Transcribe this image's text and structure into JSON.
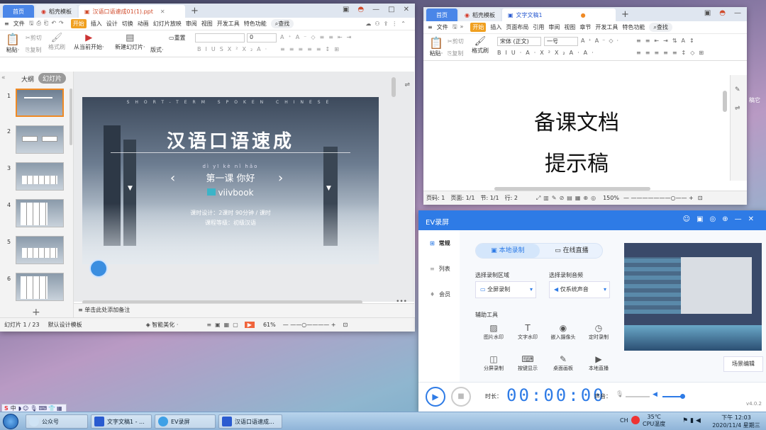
{
  "ppt": {
    "tabs": {
      "home": "首页",
      "template": "稻壳模板",
      "doc": "汉语口语速成01(1).ppt"
    },
    "menu": [
      "文件",
      "开始",
      "插入",
      "设计",
      "切换",
      "动画",
      "幻灯片放映",
      "审阅",
      "视图",
      "开发工具",
      "特色功能"
    ],
    "menu_start": "开始",
    "search": "查找",
    "ribbon": {
      "paste": "粘贴",
      "cut": "剪切",
      "copy": "复制",
      "format_painter": "格式刷",
      "play_from_current": "从当前开始",
      "new_slide": "新建幻灯片",
      "layout": "版式",
      "reset": "重置",
      "font_size": "0"
    },
    "panel_tabs": {
      "outline": "大纲",
      "slides": "幻灯片"
    },
    "thumb_numbers": [
      "1",
      "2",
      "3",
      "4",
      "5",
      "6"
    ],
    "slide": {
      "banner": "SHORT-TERM SPOKEN CHINESE",
      "title": "汉语口语速成",
      "pinyin": "dì yī kè  nǐ hǎo",
      "lesson": "第一课 你好",
      "brand": "viivbook",
      "info1": "课时设计：2课时  90分钟 / 课时",
      "info2": "课程等级：初级汉语"
    },
    "notes": "单击此处添加备注",
    "status": {
      "slide_count": "幻灯片 1 / 23",
      "template": "默认设计模板",
      "beautify": "智能美化",
      "zoom": "61%"
    }
  },
  "word": {
    "tabs": {
      "home": "首页",
      "template": "稻壳模板",
      "doc": "文字文稿1"
    },
    "menu": [
      "文件",
      "开始",
      "插入",
      "页面布局",
      "引用",
      "审阅",
      "视图",
      "章节",
      "开发工具",
      "特色功能"
    ],
    "menu_start": "开始",
    "search": "查找",
    "ribbon": {
      "paste": "粘贴",
      "cut": "剪切",
      "copy": "复制",
      "format_painter": "格式刷",
      "font": "宋体 (正文)",
      "size": "一号"
    },
    "doc_line1": "备课文档",
    "doc_line2": "提示稿",
    "status": {
      "page": "页码: 1",
      "pages": "页面: 1/1",
      "section": "节: 1/1",
      "row": "行: 2",
      "zoom": "150%"
    }
  },
  "ev": {
    "title": "EV录屏",
    "nav": [
      "常规",
      "列表",
      "会员"
    ],
    "mode_tabs": [
      "本地录制",
      "在线直播"
    ],
    "area_label": "选择录制区域",
    "area_value": "全屏录制",
    "audio_label": "选择录制音频",
    "audio_value": "仅系统声音",
    "tools_label": "辅助工具",
    "tools_row1": [
      "图片水印",
      "文字水印",
      "嵌入摄像头",
      "定时录制"
    ],
    "tools_row2": [
      "分屏录制",
      "按键显示",
      "桌面画板",
      "本地直播"
    ],
    "scene_btn": "场景编辑",
    "duration_label": "时长：",
    "timer": "00:00:00",
    "volume_label": "声音：",
    "version": "v4.0.2"
  },
  "taskbar": {
    "items": [
      "公众号",
      "文字文稿1 - ...",
      "EV录屏",
      "汉语口语速成..."
    ],
    "cpu_temp": "35℃",
    "cpu_label": "CPU温度",
    "time": "下午 12:03",
    "date": "2020/11/4 星期三",
    "ime": "中"
  },
  "desktop_hint": "稿它"
}
